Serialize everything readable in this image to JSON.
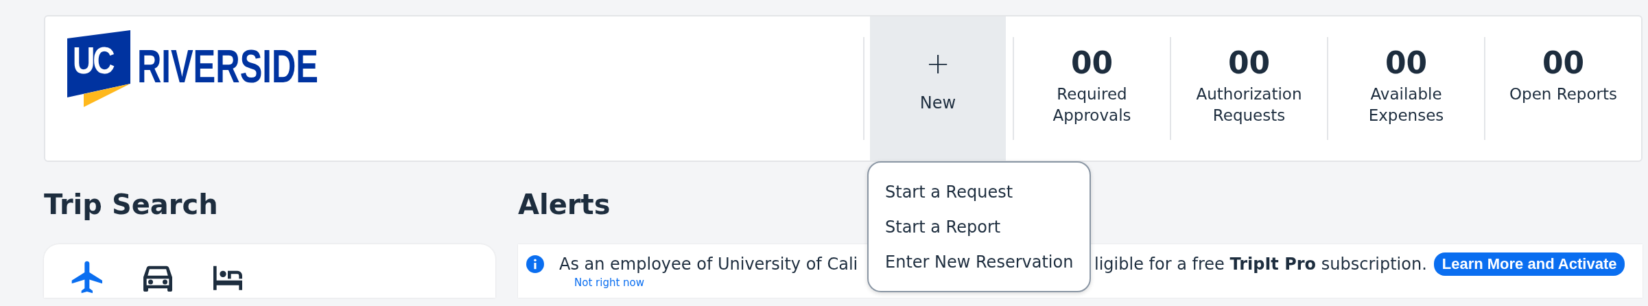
{
  "logo": {
    "mark": "UC",
    "name": "RIVERSIDE"
  },
  "new_tile": {
    "icon": "+",
    "label": "New",
    "selected": true
  },
  "stats": [
    {
      "value": "00",
      "label": "Required Approvals"
    },
    {
      "value": "00",
      "label": "Authorization Requests"
    },
    {
      "value": "00",
      "label": "Available Expenses"
    },
    {
      "value": "00",
      "label": "Open Reports"
    }
  ],
  "new_menu": {
    "expanded": true,
    "items": [
      "Start a Request",
      "Start a Report",
      "Enter New Reservation"
    ]
  },
  "trip_search": {
    "title": "Trip Search",
    "modes": [
      {
        "kind": "flight",
        "selected": true
      },
      {
        "kind": "car",
        "selected": false
      },
      {
        "kind": "hotel",
        "selected": false
      }
    ]
  },
  "alerts": {
    "title": "Alerts",
    "items": [
      {
        "text_before": "As an employee of University of Cali",
        "text_after": "ligible for a free **TripIt Pro** subscription.",
        "button": "Learn More and Activate",
        "link": "Not right now"
      }
    ]
  }
}
